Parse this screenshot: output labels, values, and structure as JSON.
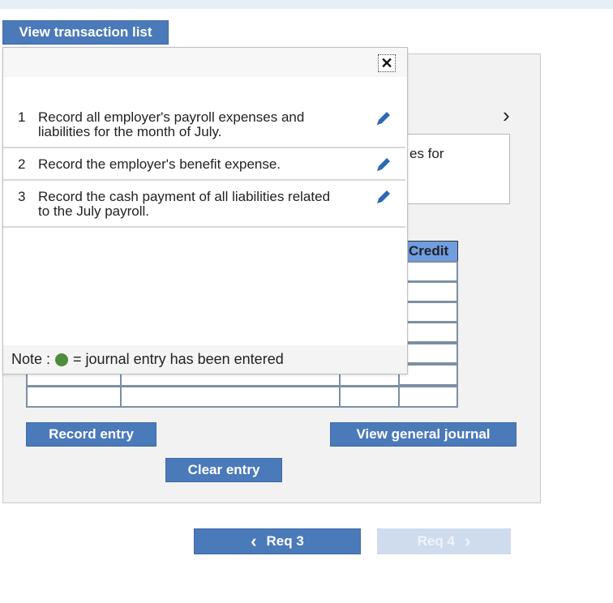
{
  "header": {
    "view_list_label": "View transaction list"
  },
  "popup": {
    "close_label": "✕",
    "rows": [
      {
        "num": "1",
        "text": "Record all employer's payroll expenses and liabilities for the month of July."
      },
      {
        "num": "2",
        "text": "Record the employer's benefit expense."
      },
      {
        "num": "3",
        "text": "Record the cash payment of all liabilities related to the July payroll."
      }
    ],
    "note_prefix": "Note :",
    "note_suffix": "= journal entry has been entered"
  },
  "panel": {
    "next_chevron": "›",
    "desc_partial": "es for",
    "credit_header": "Credit",
    "record_entry_label": "Record entry",
    "clear_entry_label": "Clear entry",
    "view_journal_label": "View general journal"
  },
  "nav": {
    "prev_label": "Req 3",
    "prev_icon": "‹",
    "next_label": "Req 4",
    "next_icon": "›"
  },
  "colors": {
    "button_blue": "#4a7ab9",
    "credit_header_blue": "#6f9de0",
    "entered_dot_green": "#4d8c3d",
    "pencil_blue": "#2f68b4"
  }
}
